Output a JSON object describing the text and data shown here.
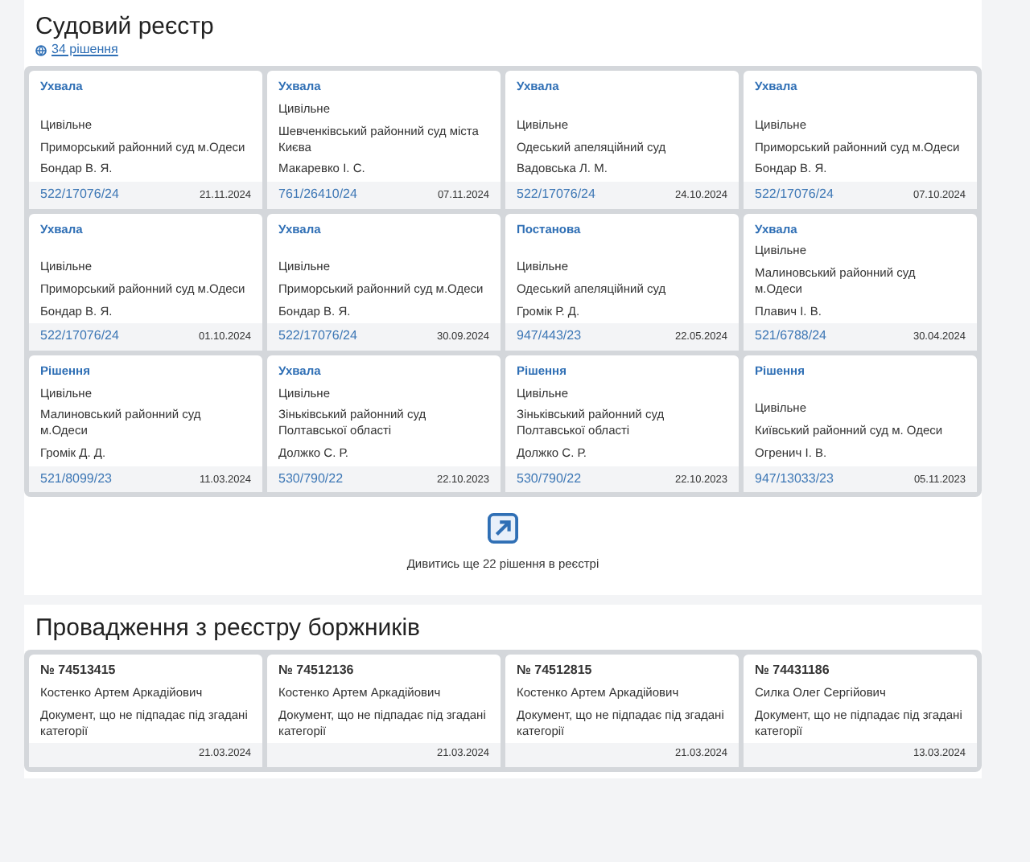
{
  "court_registry": {
    "title": "Судовий реєстр",
    "count_link": "34 рішення",
    "decisions": [
      {
        "type": "Ухвала",
        "category": "Цивільне",
        "court": "Приморський районний суд м.Одеси",
        "judge": "Бондар В. Я.",
        "case_number": "522/17076/24",
        "date": "21.11.2024"
      },
      {
        "type": "Ухвала",
        "category": "Цивільне",
        "court": "Шевченківський районний суд міста Києва",
        "judge": "Макаревко І. С.",
        "case_number": "761/26410/24",
        "date": "07.11.2024"
      },
      {
        "type": "Ухвала",
        "category": "Цивільне",
        "court": "Одеський апеляційний суд",
        "judge": "Вадовська Л. М.",
        "case_number": "522/17076/24",
        "date": "24.10.2024"
      },
      {
        "type": "Ухвала",
        "category": "Цивільне",
        "court": "Приморський районний суд м.Одеси",
        "judge": "Бондар В. Я.",
        "case_number": "522/17076/24",
        "date": "07.10.2024"
      },
      {
        "type": "Ухвала",
        "category": "Цивільне",
        "court": "Приморський районний суд м.Одеси",
        "judge": "Бондар В. Я.",
        "case_number": "522/17076/24",
        "date": "01.10.2024"
      },
      {
        "type": "Ухвала",
        "category": "Цивільне",
        "court": "Приморський районний суд м.Одеси",
        "judge": "Бондар В. Я.",
        "case_number": "522/17076/24",
        "date": "30.09.2024"
      },
      {
        "type": "Постанова",
        "category": "Цивільне",
        "court": "Одеський апеляційний суд",
        "judge": "Громік Р. Д.",
        "case_number": "947/443/23",
        "date": "22.05.2024"
      },
      {
        "type": "Ухвала",
        "category": "Цивільне",
        "court": "Малиновський районний суд м.Одеси",
        "judge": "Плавич І. В.",
        "case_number": "521/6788/24",
        "date": "30.04.2024"
      },
      {
        "type": "Рішення",
        "category": "Цивільне",
        "court": "Малиновський районний суд м.Одеси",
        "judge": "Громік Д. Д.",
        "case_number": "521/8099/23",
        "date": "11.03.2024"
      },
      {
        "type": "Ухвала",
        "category": "Цивільне",
        "court": "Зіньківський районний суд Полтавської області",
        "judge": "Должко С. Р.",
        "case_number": "530/790/22",
        "date": "22.10.2023"
      },
      {
        "type": "Рішення",
        "category": "Цивільне",
        "court": "Зіньківський районний суд Полтавської області",
        "judge": "Должко С. Р.",
        "case_number": "530/790/22",
        "date": "22.10.2023"
      },
      {
        "type": "Рішення",
        "category": "Цивільне",
        "court": "Київський районний суд м. Одеси",
        "judge": "Огренич І. В.",
        "case_number": "947/13033/23",
        "date": "05.11.2023"
      }
    ],
    "more_link": "Дивитись ще 22 рішення в реєстрі"
  },
  "debtors": {
    "title": "Провадження з реєстру боржників",
    "items": [
      {
        "number": "№ 74513415",
        "name": "Костенко Артем Аркадійович",
        "description": "Документ, що не підпадає під згадані категорії",
        "date": "21.03.2024"
      },
      {
        "number": "№ 74512136",
        "name": "Костенко Артем Аркадійович",
        "description": "Документ, що не підпадає під згадані категорії",
        "date": "21.03.2024"
      },
      {
        "number": "№ 74512815",
        "name": "Костенко Артем Аркадійович",
        "description": "Документ, що не підпадає під згадані категорії",
        "date": "21.03.2024"
      },
      {
        "number": "№ 74431186",
        "name": "Силка Олег Сергійович",
        "description": "Документ, що не підпадає під згадані категорії",
        "date": "13.03.2024"
      }
    ]
  }
}
